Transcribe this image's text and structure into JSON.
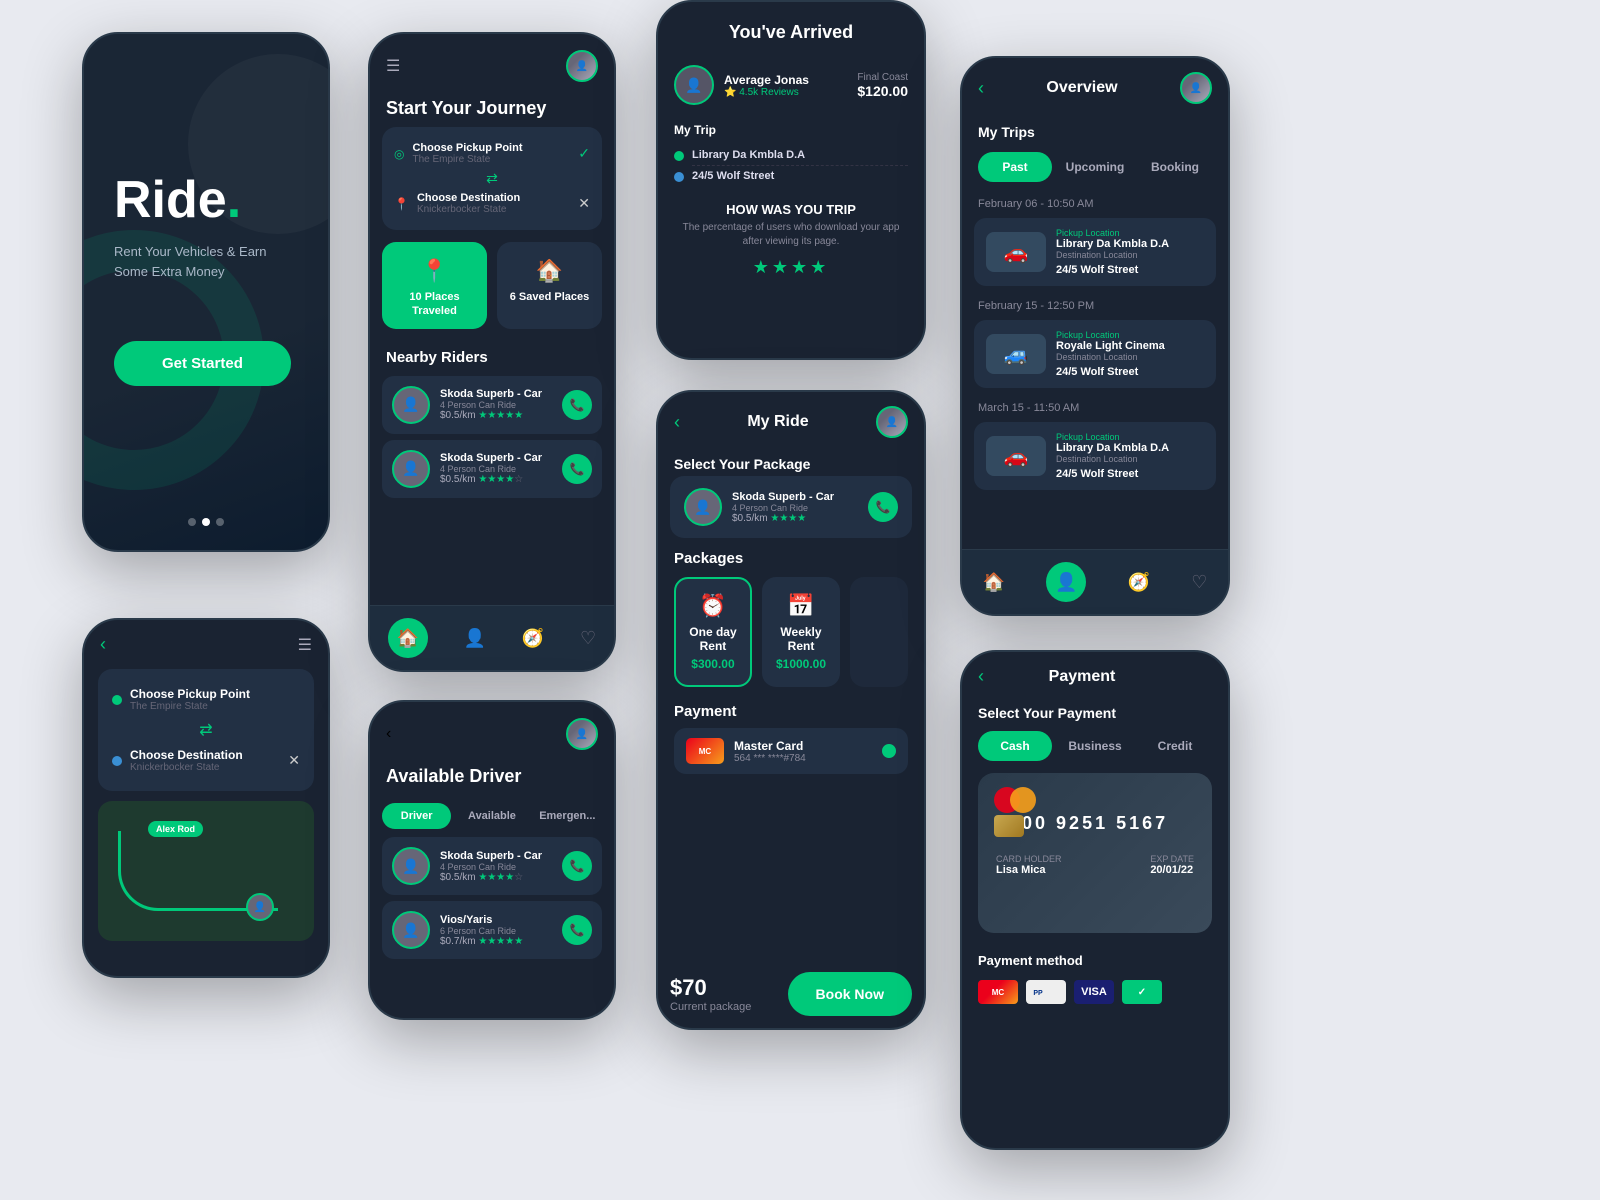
{
  "app": {
    "name": "Ride",
    "tagline1": "Rent Your Vehicles & Earn",
    "tagline2": "Some Extra Money",
    "dot": ".",
    "get_started": "Get Started"
  },
  "journey": {
    "title": "Start Your Journey",
    "pickup_label": "Choose Pickup Point",
    "pickup_value": "The Empire State",
    "dest_label": "Choose Destination",
    "dest_value": "Knickerbocker State",
    "btn1_label": "10 Places Traveled",
    "btn2_label": "6 Saved Places",
    "nearby_title": "Nearby Riders",
    "riders": [
      {
        "name": "Skoda Superb - Car",
        "seats": "4 Person Can Ride",
        "price": "$0.5/km",
        "stars": "★★★★★"
      },
      {
        "name": "Skoda Superb - Car",
        "seats": "4 Person Can Ride",
        "price": "$0.5/km",
        "stars": "★★★★☆"
      }
    ]
  },
  "driver": {
    "title": "Available Driver",
    "tabs": [
      "Driver",
      "Available",
      "Emergency"
    ],
    "drivers": [
      {
        "name": "Skoda Superb - Car",
        "seats": "4 Person Can Ride",
        "price": "$0.5/km",
        "stars": "★★★★☆"
      },
      {
        "name": "Vios/Yaris",
        "seats": "6 Person Can Ride",
        "price": "$0.7/km",
        "stars": "★★★★★"
      }
    ]
  },
  "arrived": {
    "title": "You've Arrived",
    "driver_name": "Average Jonas",
    "driver_reviews": "4.5k Reviews",
    "final_cost_label": "Final Coast",
    "final_cost": "$120.00",
    "trip_label": "My Trip",
    "pickup": "Library Da Kmbla D.A",
    "destination": "24/5 Wolf Street",
    "rating_q": "HOW WAS YOU TRIP",
    "rating_sub": "The percentage of users who download your app after viewing its page.",
    "stars": "★★★★"
  },
  "myride": {
    "title": "My Ride",
    "select_pkg_label": "Select Your Package",
    "driver_name": "Skoda Superb - Car",
    "driver_seats": "4 Person Can Ride",
    "driver_price": "$0.5/km",
    "driver_stars": "★★★★",
    "packages_label": "Packages",
    "packages": [
      {
        "name": "One day Rent",
        "icon": "⏰",
        "price": "$300.00"
      },
      {
        "name": "Weekly Rent",
        "icon": "📅",
        "price": "$1000.00"
      }
    ],
    "payment_label": "Payment",
    "card_name": "Master Card",
    "card_num": "564 *** ****#784",
    "current_price": "$70",
    "current_label": "Current package",
    "book_btn": "Book Now"
  },
  "overview": {
    "title": "Overview",
    "my_trips": "My Trips",
    "tabs": [
      "Past",
      "Upcoming",
      "Booking"
    ],
    "trips": [
      {
        "date": "February 06 - 10:50 AM",
        "pickup": "Library Da Kmbla D.A",
        "pickup_label": "Pickup Location",
        "dest": "24/5 Wolf Street",
        "dest_label": "Destination Location"
      },
      {
        "date": "February 15 - 12:50 PM",
        "pickup": "Royale Light Cinema",
        "pickup_label": "Pickup Location",
        "dest": "24/5 Wolf Street",
        "dest_label": "Destination Location"
      },
      {
        "date": "March 15 - 11:50 AM",
        "pickup": "Library Da Kmbla D.A",
        "pickup_label": "Pickup Location",
        "dest": "24/5 Wolf Street",
        "dest_label": "Destination Location"
      }
    ]
  },
  "payment": {
    "title": "Payment",
    "select_label": "Select Your Payment",
    "tabs": [
      "Cash",
      "Business",
      "Credit"
    ],
    "card_number": "4200 9251 5167",
    "card_holder": "Lisa Mica",
    "card_expiry": "20/01/22",
    "card_holder_label": "CARD HOLDER",
    "card_expiry_label": "EXP DATE",
    "method_label": "Payment method"
  },
  "map": {
    "pickup": "Choose Pickup Point",
    "pickup_sub": "The Empire State",
    "dest": "Choose Destination",
    "dest_sub": "Knickerbocker State",
    "pin_label": "Alex Rod"
  },
  "colors": {
    "primary": "#00c97a",
    "dark_bg": "#1a2332",
    "card_bg": "#223044"
  }
}
